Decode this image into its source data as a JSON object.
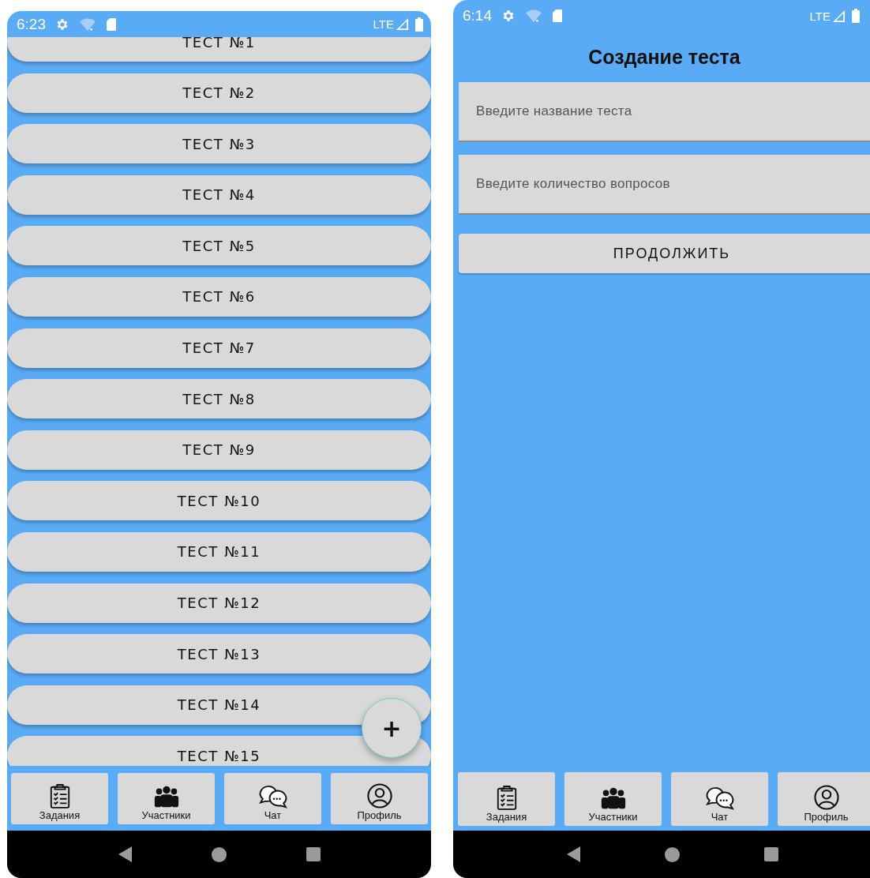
{
  "screens": [
    {
      "kind": "list",
      "status_bar": {
        "time": "6:23",
        "network": "LTE"
      },
      "items": [
        {
          "label": "ТЕСТ №1"
        },
        {
          "label": "ТЕСТ №2"
        },
        {
          "label": "ТЕСТ №3"
        },
        {
          "label": "ТЕСТ №4"
        },
        {
          "label": "ТЕСТ №5"
        },
        {
          "label": "ТЕСТ №6"
        },
        {
          "label": "ТЕСТ №7"
        },
        {
          "label": "ТЕСТ №8"
        },
        {
          "label": "ТЕСТ №9"
        },
        {
          "label": "ТЕСТ №10"
        },
        {
          "label": "ТЕСТ №11"
        },
        {
          "label": "ТЕСТ №12"
        },
        {
          "label": "ТЕСТ №13"
        },
        {
          "label": "ТЕСТ №14"
        },
        {
          "label": "ТЕСТ №15"
        }
      ],
      "fab": {
        "label": "+"
      },
      "nav": [
        {
          "kind": "tasks",
          "label": "Задания"
        },
        {
          "kind": "people",
          "label": "Участники"
        },
        {
          "kind": "chat",
          "label": "Чат"
        },
        {
          "kind": "profile",
          "label": "Профиль"
        }
      ]
    },
    {
      "kind": "form",
      "status_bar": {
        "time": "6:14",
        "network": "LTE"
      },
      "title": "Создание теста",
      "fields": [
        {
          "placeholder": "Введите название теста"
        },
        {
          "placeholder": "Введите количество вопросов"
        }
      ],
      "button": "ПРОДОЛЖИТЬ",
      "nav": [
        {
          "kind": "tasks",
          "label": "Задания"
        },
        {
          "kind": "people",
          "label": "Участники"
        },
        {
          "kind": "chat",
          "label": "Чат"
        },
        {
          "kind": "profile",
          "label": "Профиль"
        }
      ]
    }
  ]
}
